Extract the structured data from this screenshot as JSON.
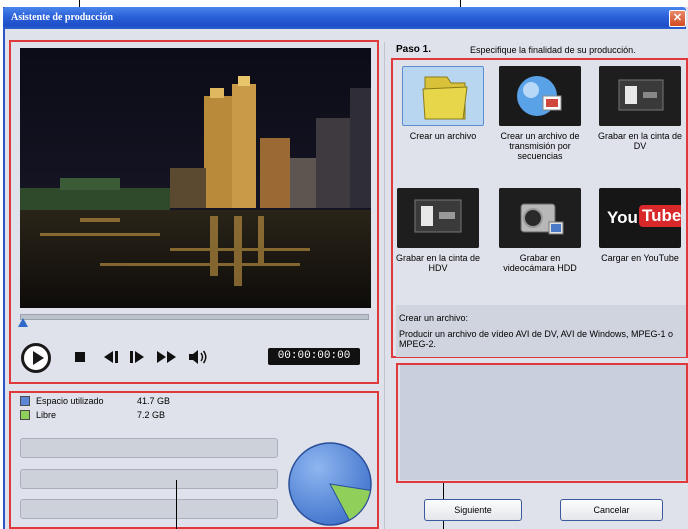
{
  "window": {
    "title": "Asistente de producción",
    "close_glyph": "✕"
  },
  "player": {
    "timecode": "00:00:00:00",
    "icons": [
      "play-icon",
      "stop-icon",
      "previous-frame-icon",
      "next-frame-icon",
      "fast-forward-icon",
      "volume-icon"
    ]
  },
  "disk": {
    "used_label": "Espacio utilizado",
    "used_value": "41.7  GB",
    "used_color": "#5b87d6",
    "free_label": "Libre",
    "free_value": "7.2  GB",
    "free_color": "#8fcf5a",
    "used_fraction": 0.853
  },
  "step": {
    "label": "Paso 1.",
    "description": "Especifique la finalidad de su producción."
  },
  "options": [
    {
      "label": "Crear un archivo",
      "icon": "folder-icon"
    },
    {
      "label": "Crear un archivo de transmisión por secuencias",
      "icon": "streaming-globe-icon"
    },
    {
      "label": "Grabar en la cinta de DV",
      "icon": "dv-tape-icon"
    },
    {
      "label": "Grabar en la cinta de HDV",
      "icon": "hdv-tape-icon"
    },
    {
      "label": "Grabar en videocámara HDD",
      "icon": "camcorder-icon"
    },
    {
      "label": "Cargar en YouTube",
      "icon": "youtube-icon"
    }
  ],
  "youtube_logo": {
    "you": "You",
    "tube": "Tube"
  },
  "selection": {
    "title": "Crear un archivo:",
    "body": "Producir un archivo de vídeo AVI de DV, AVI de Windows, MPEG-1 o MPEG-2."
  },
  "buttons": {
    "next": "Siguiente",
    "cancel": "Cancelar"
  }
}
